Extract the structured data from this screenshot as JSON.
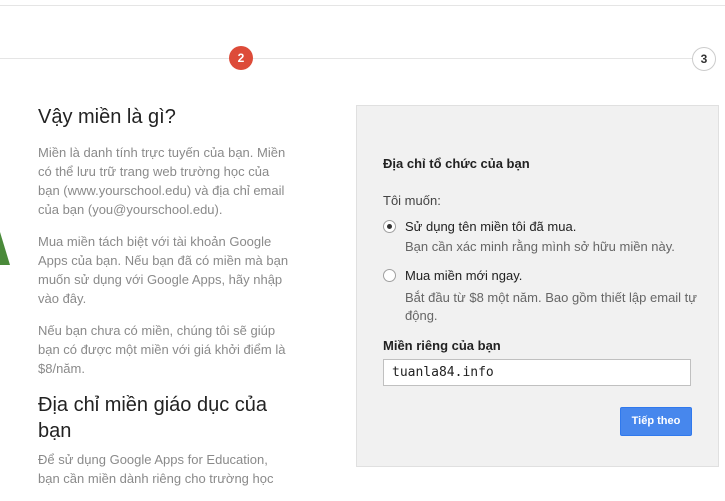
{
  "progress": {
    "step_2": "2",
    "step_3": "3"
  },
  "left": {
    "heading_1": "Vậy miền là gì?",
    "para_1": "Miền là danh tính trực tuyến của bạn. Miền có thể lưu trữ trang web trường học của bạn (www.yourschool.edu) và địa chỉ email của bạn (you@yourschool.edu).",
    "para_2": "Mua miền tách biệt với tài khoản Google Apps của bạn. Nếu bạn đã có miền mà bạn muốn sử dụng với Google Apps, hãy nhập vào đây.",
    "para_3": "Nếu bạn chưa có miền, chúng tôi sẽ giúp bạn có được một miền với giá khởi điểm là $8/năm.",
    "heading_2": "Địa chỉ miền giáo dục của bạn",
    "para_4": "Để sử dụng Google Apps for Education, bạn cần miền dành riêng cho trường học"
  },
  "panel": {
    "title": "Địa chỉ tổ chức của bạn",
    "want_label": "Tôi muốn:",
    "option_1_label": "Sử dụng tên miền tôi đã mua.",
    "option_1_desc": "Bạn cần xác minh rằng mình sở hữu miền này.",
    "option_2_label": "Mua miền mới ngay.",
    "option_2_desc": "Bắt đầu từ $8 một năm. Bao gồm thiết lập email tự động.",
    "selected_option": "option_1",
    "domain_label": "Miền riêng của bạn",
    "domain_value": "tuanla84.info",
    "next_button": "Tiếp theo"
  },
  "colors": {
    "step_active": "#dd4b39",
    "button_blue": "#4787ed",
    "panel_bg": "#f1f1f1"
  }
}
